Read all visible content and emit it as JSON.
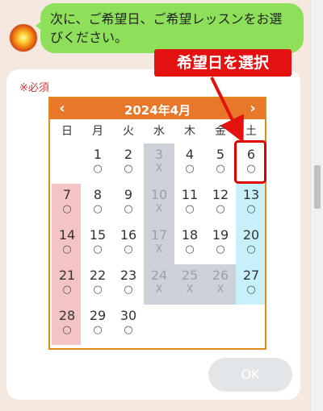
{
  "chat": {
    "message": "次に、ご希望日、ご希望レッスンをお選びください。"
  },
  "form": {
    "required_label": "※必須",
    "ok_label": "OK"
  },
  "calendar": {
    "title": "2024年4月",
    "prev_icon": "◀",
    "next_icon": "▶",
    "weekdays": [
      "日",
      "月",
      "火",
      "水",
      "木",
      "金",
      "土"
    ],
    "days": [
      {
        "day": "1",
        "mark": "○"
      },
      {
        "day": "2",
        "mark": "○"
      },
      {
        "day": "3",
        "mark": "X"
      },
      {
        "day": "4",
        "mark": "○"
      },
      {
        "day": "5",
        "mark": "○"
      },
      {
        "day": "6",
        "mark": "○"
      },
      {
        "day": "7",
        "mark": "○"
      },
      {
        "day": "8",
        "mark": "○"
      },
      {
        "day": "9",
        "mark": "○"
      },
      {
        "day": "10",
        "mark": "X"
      },
      {
        "day": "11",
        "mark": "○"
      },
      {
        "day": "12",
        "mark": "○"
      },
      {
        "day": "13",
        "mark": "○"
      },
      {
        "day": "14",
        "mark": "○"
      },
      {
        "day": "15",
        "mark": "○"
      },
      {
        "day": "16",
        "mark": "○"
      },
      {
        "day": "17",
        "mark": "X"
      },
      {
        "day": "18",
        "mark": "○"
      },
      {
        "day": "19",
        "mark": "○"
      },
      {
        "day": "20",
        "mark": "○"
      },
      {
        "day": "21",
        "mark": "○"
      },
      {
        "day": "22",
        "mark": "○"
      },
      {
        "day": "23",
        "mark": "○"
      },
      {
        "day": "24",
        "mark": "X"
      },
      {
        "day": "25",
        "mark": "X"
      },
      {
        "day": "26",
        "mark": "X"
      },
      {
        "day": "27",
        "mark": "○"
      },
      {
        "day": "28",
        "mark": "○"
      },
      {
        "day": "29",
        "mark": "○"
      },
      {
        "day": "30",
        "mark": "○"
      }
    ],
    "highlighted_day": "6"
  },
  "annotation": {
    "label": "希望日を選択"
  },
  "colors": {
    "header": "#e8772a",
    "border": "#e08a1e",
    "sunday_bg": "#f4c4c4",
    "saturday_bg": "#c7f0fb",
    "unavailable_bg": "#cdd2d8",
    "highlight": "#e00000",
    "bubble": "#8ee05a"
  }
}
